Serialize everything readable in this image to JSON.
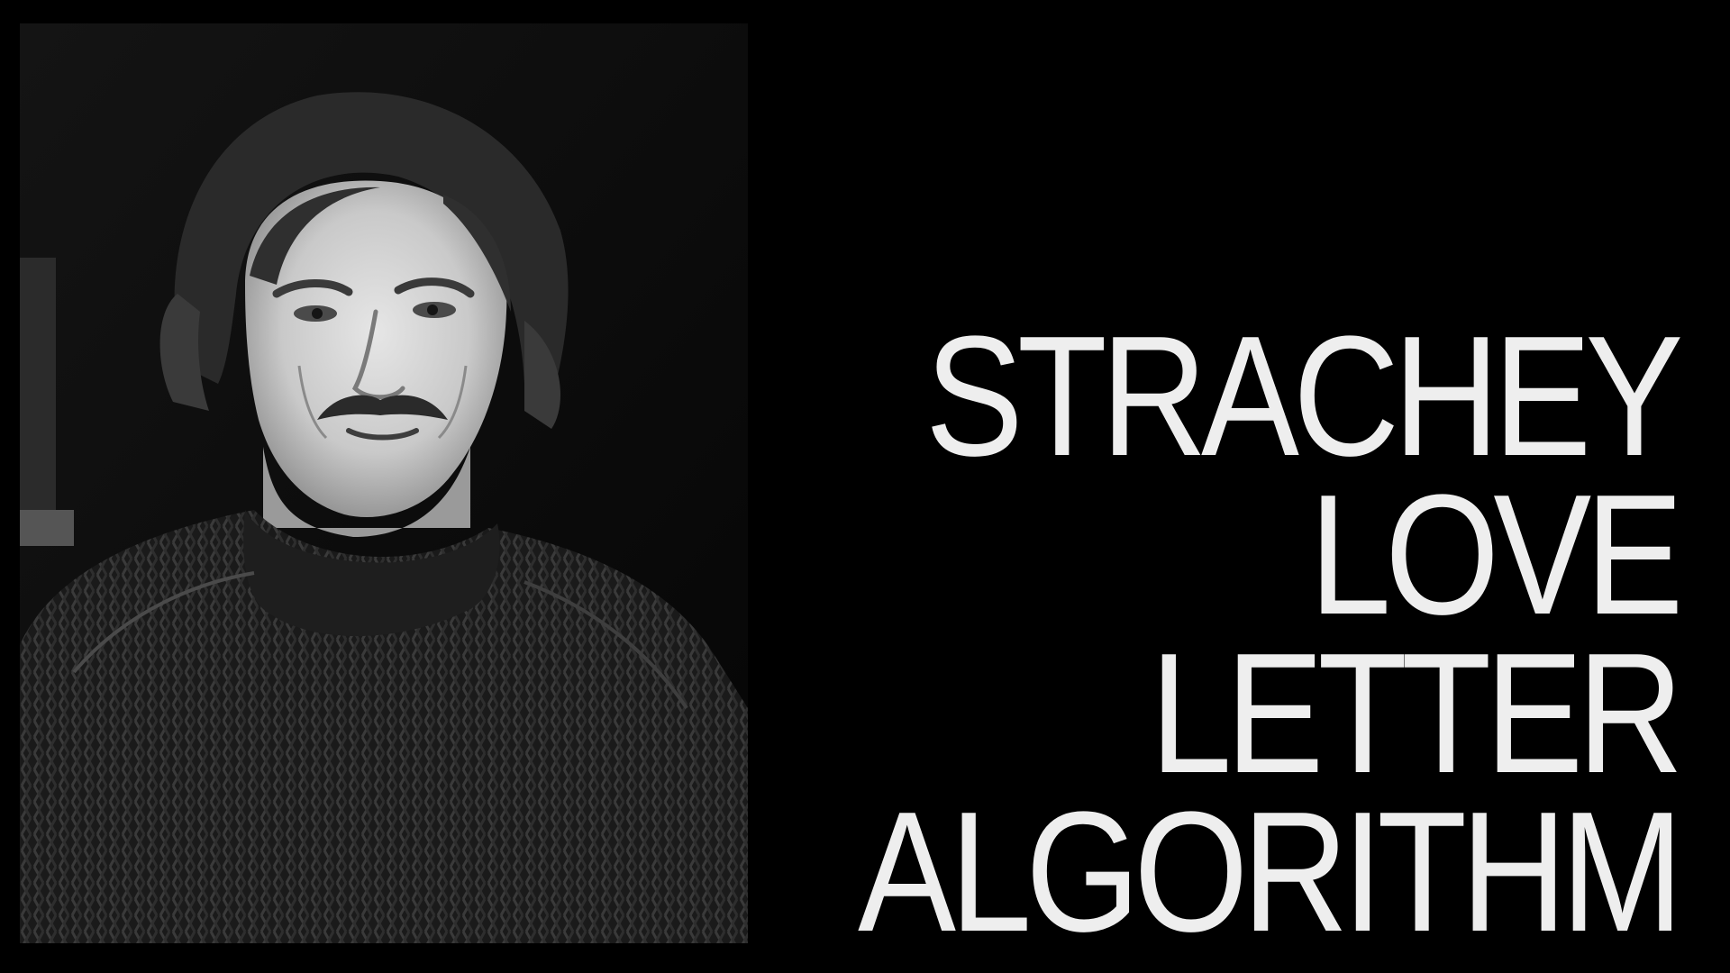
{
  "title": {
    "lines": [
      "STRACHEY",
      "LOVE",
      "LETTER",
      "ALGORITHM"
    ]
  },
  "colors": {
    "background": "#000000",
    "text": "#eeeeee"
  },
  "photo": {
    "style": "black-and-white portrait"
  }
}
